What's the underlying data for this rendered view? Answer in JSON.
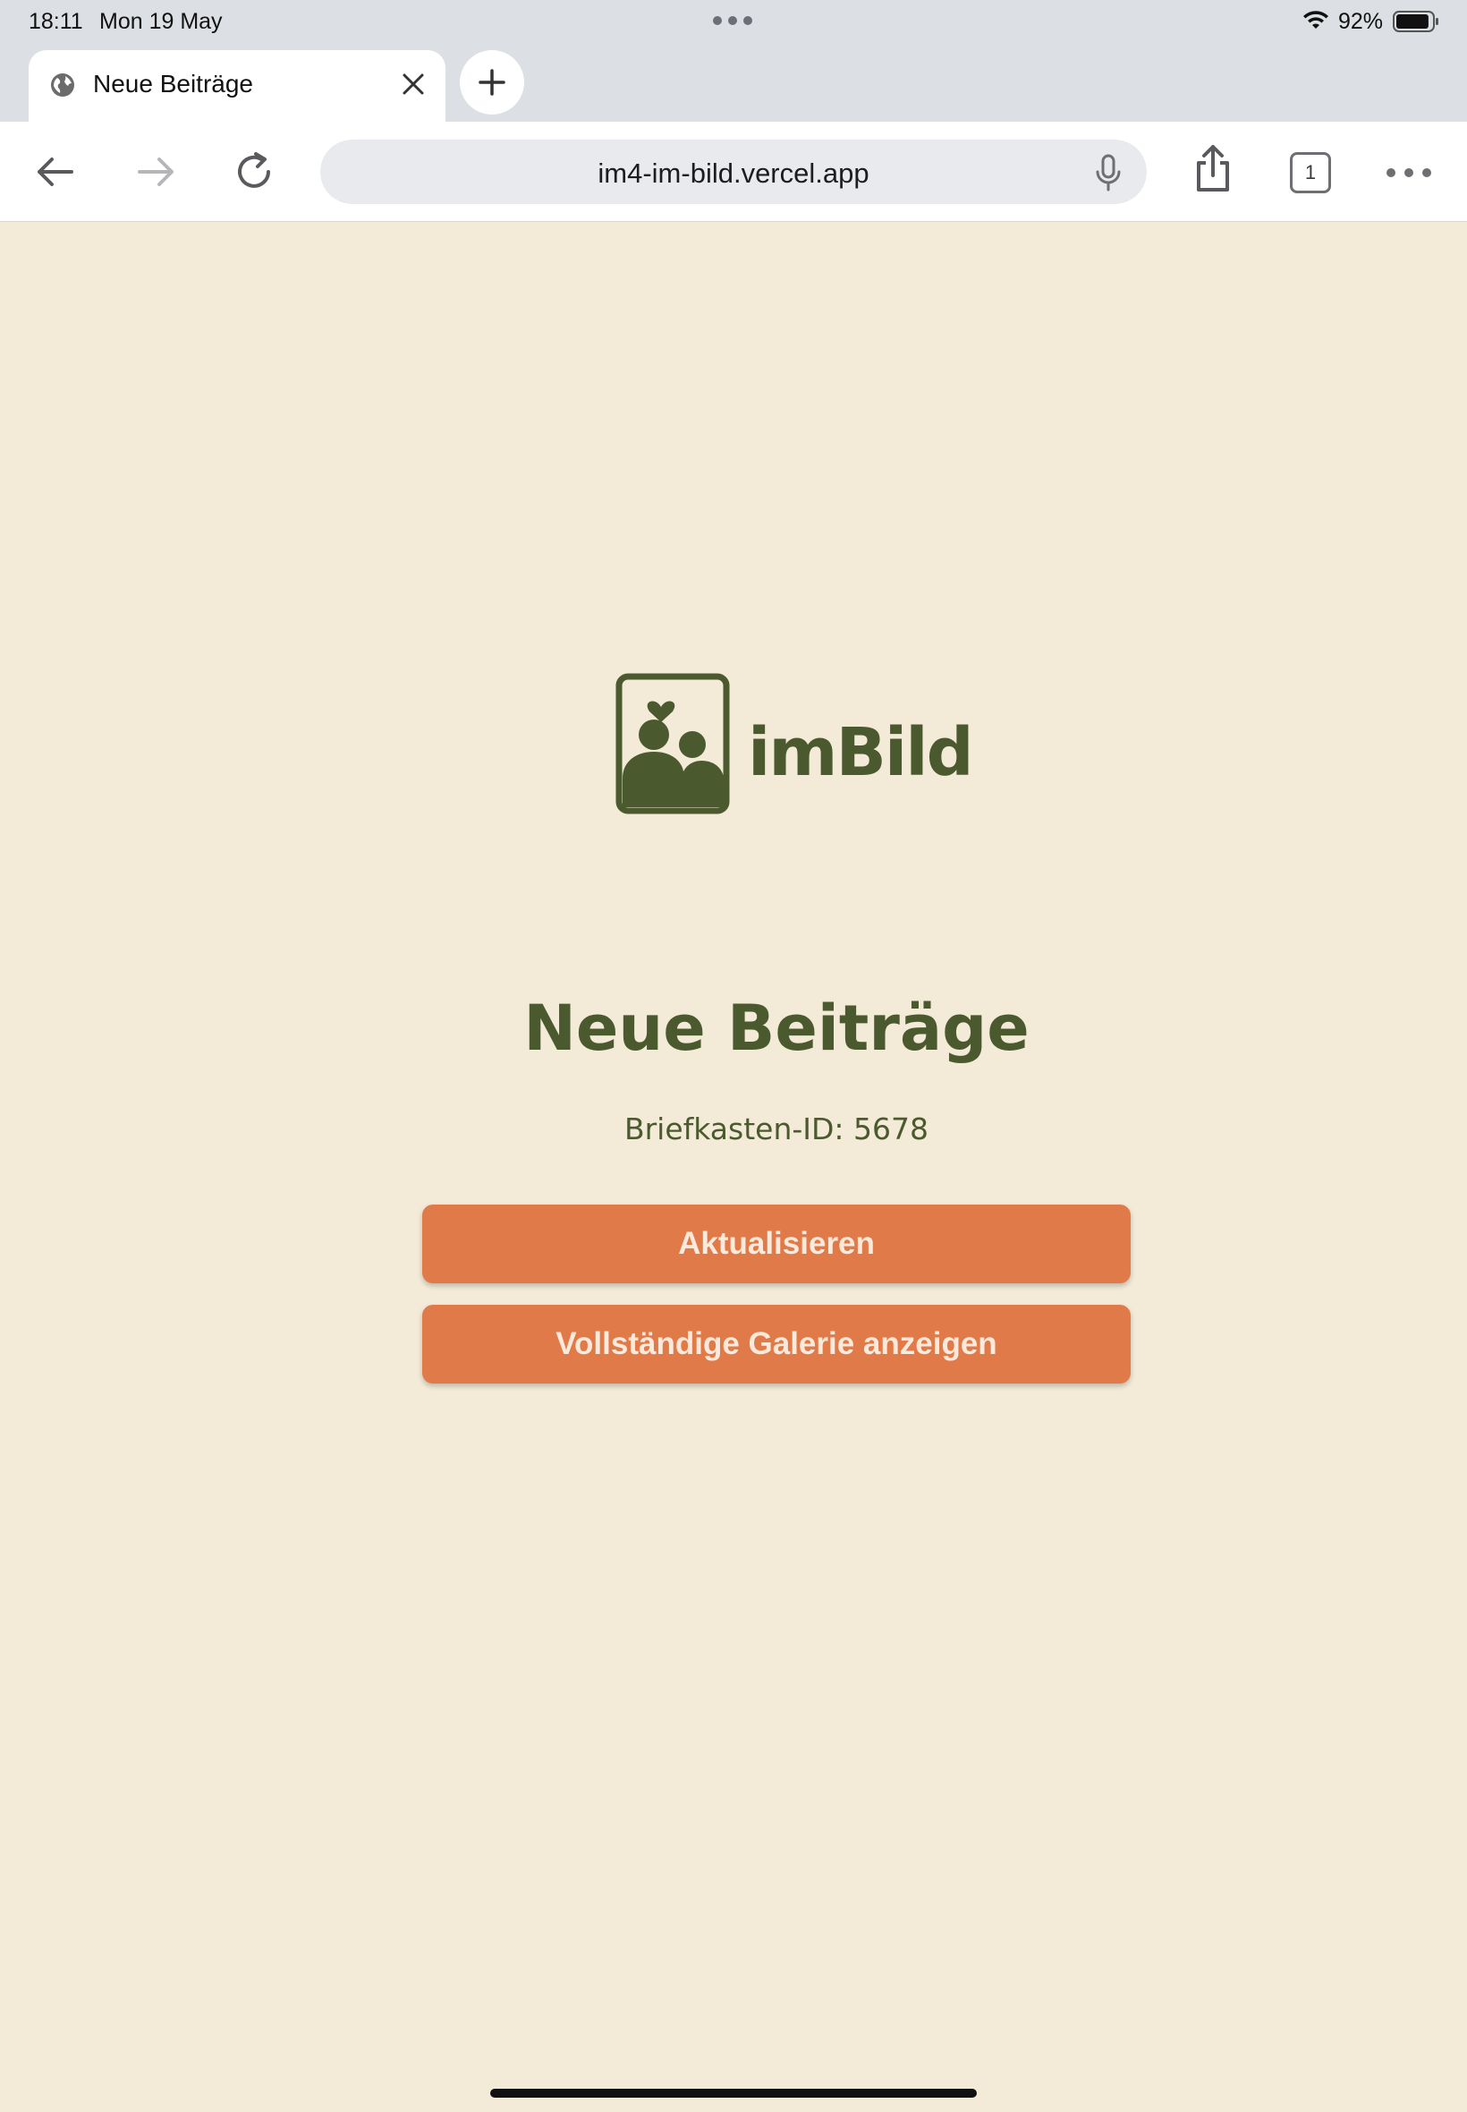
{
  "status_bar": {
    "time": "18:11",
    "date": "Mon 19 May",
    "battery_percent": "92%",
    "battery_level": 0.92
  },
  "browser": {
    "tab_title": "Neue Beiträge",
    "url": "im4-im-bild.vercel.app",
    "tab_count": "1",
    "icons": {
      "back": "arrow-left-icon",
      "forward": "arrow-right-icon",
      "reload": "reload-icon",
      "share": "share-icon",
      "mic": "microphone-icon",
      "more": "more-icon"
    }
  },
  "page": {
    "logo_text": "imBild",
    "title": "Neue Beiträge",
    "mailbox_id": "Briefkasten-ID: 5678",
    "buttons": {
      "refresh": "Aktualisieren",
      "gallery": "Vollständige Galerie anzeigen"
    }
  },
  "colors": {
    "background": "#f3ead7",
    "brand_green": "#4b5a2e",
    "button_orange": "#e07a49",
    "button_text": "#fbe9dc"
  }
}
